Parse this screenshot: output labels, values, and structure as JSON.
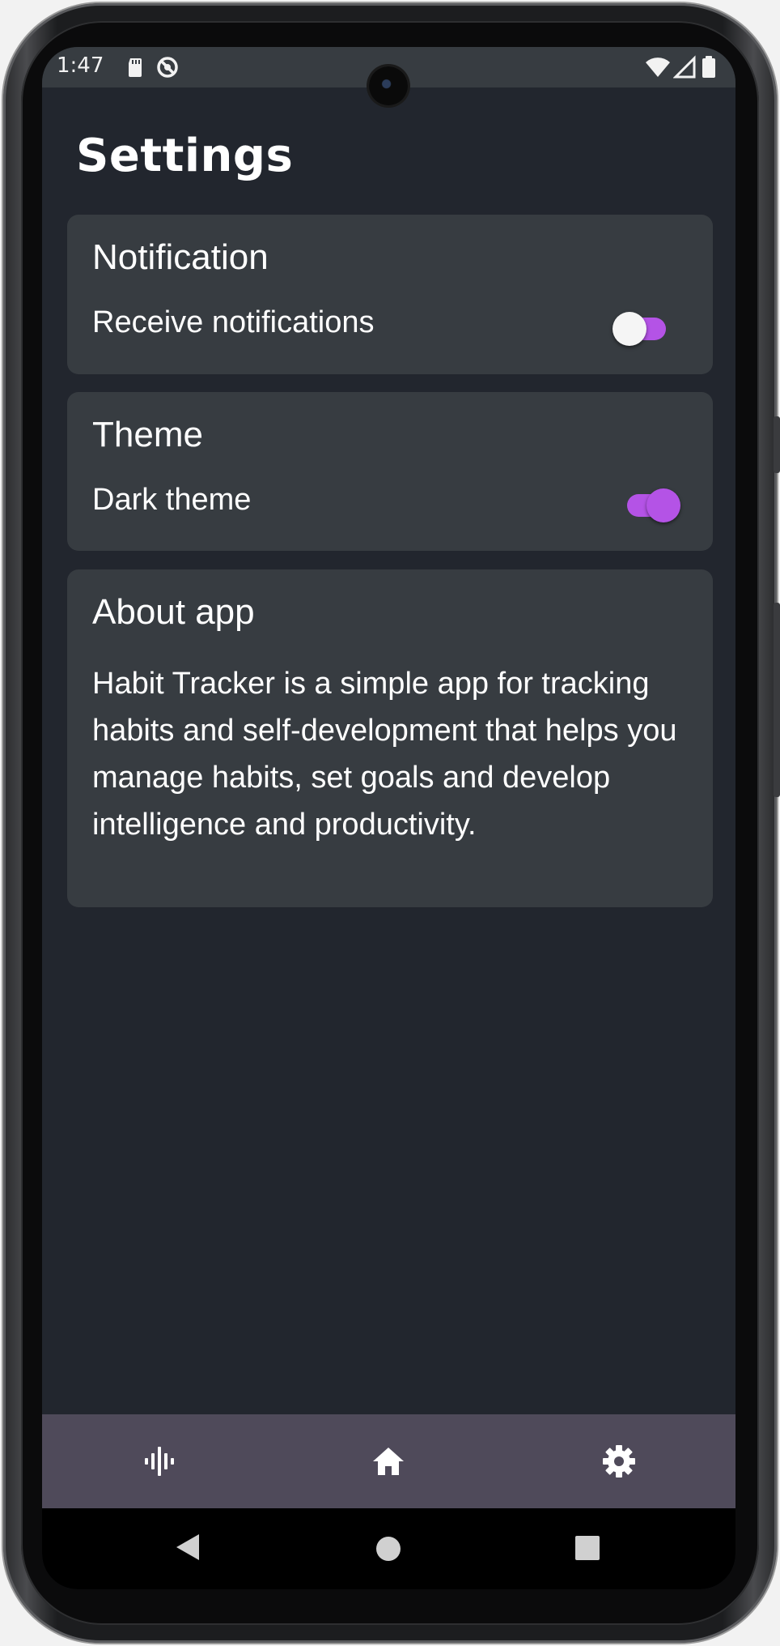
{
  "status_bar": {
    "time": "1:47",
    "left_icons": [
      "sd-card-icon",
      "no-disturb-icon"
    ],
    "right_icons": [
      "wifi-icon",
      "signal-icon",
      "battery-icon"
    ]
  },
  "page": {
    "title": "Settings"
  },
  "notification_card": {
    "title": "Notification",
    "label": "Receive notifications",
    "toggle_on": false
  },
  "theme_card": {
    "title": "Theme",
    "label": "Dark theme",
    "toggle_on": true
  },
  "about_card": {
    "title": "About app",
    "text": "Habit Tracker is a simple app for tracking habits and self-development that helps you manage habits, set goals and develop intelligence and productivity."
  },
  "bottom_nav": {
    "items": [
      {
        "icon": "statistics-icon"
      },
      {
        "icon": "home-icon"
      },
      {
        "icon": "settings-gear-icon"
      }
    ]
  },
  "system_nav": {
    "buttons": [
      "back-icon",
      "home-circle-icon",
      "recents-icon"
    ]
  },
  "colors": {
    "background": "#22262e",
    "card": "#373c41",
    "accent": "#b453e6",
    "bottom_nav": "#4f4a5a"
  }
}
